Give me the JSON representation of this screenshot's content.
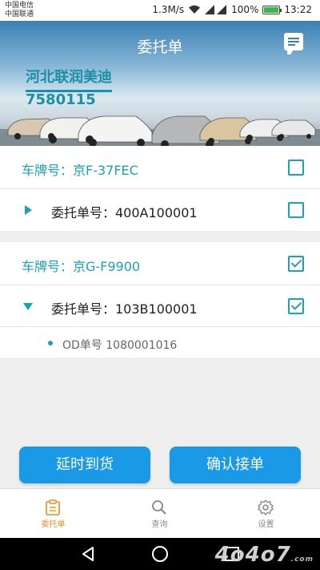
{
  "status_bar": {
    "carrier_1": "中国电信",
    "carrier_2": "中国联通",
    "speed": "1.3M/s",
    "battery": "100%",
    "time": "13:22"
  },
  "header": {
    "title": "委托单",
    "company_name": "河北联润美迪",
    "company_code": "7580115"
  },
  "orders": [
    {
      "plate_label": "车牌号：京F-37FEC",
      "order_label": "委托单号：400A100001",
      "plate_checked": false,
      "order_checked": false,
      "expanded": false
    },
    {
      "plate_label": "车牌号：京G-F9900",
      "order_label": "委托单号：103B100001",
      "plate_checked": true,
      "order_checked": true,
      "expanded": true,
      "sub_items": [
        "OD单号 1080001016"
      ]
    }
  ],
  "actions": {
    "delay_label": "延时到货",
    "confirm_label": "确认接单"
  },
  "tabs": [
    {
      "label": "委托单",
      "icon": "clipboard-icon",
      "active": true
    },
    {
      "label": "查询",
      "icon": "search-icon",
      "active": false
    },
    {
      "label": "设置",
      "icon": "gear-icon",
      "active": false
    }
  ],
  "watermark": {
    "text": "4o4o7",
    "suffix": ".com"
  },
  "colors": {
    "accent": "#1aa3b5",
    "button": "#1a99e6",
    "active_tab": "#f08c19"
  }
}
